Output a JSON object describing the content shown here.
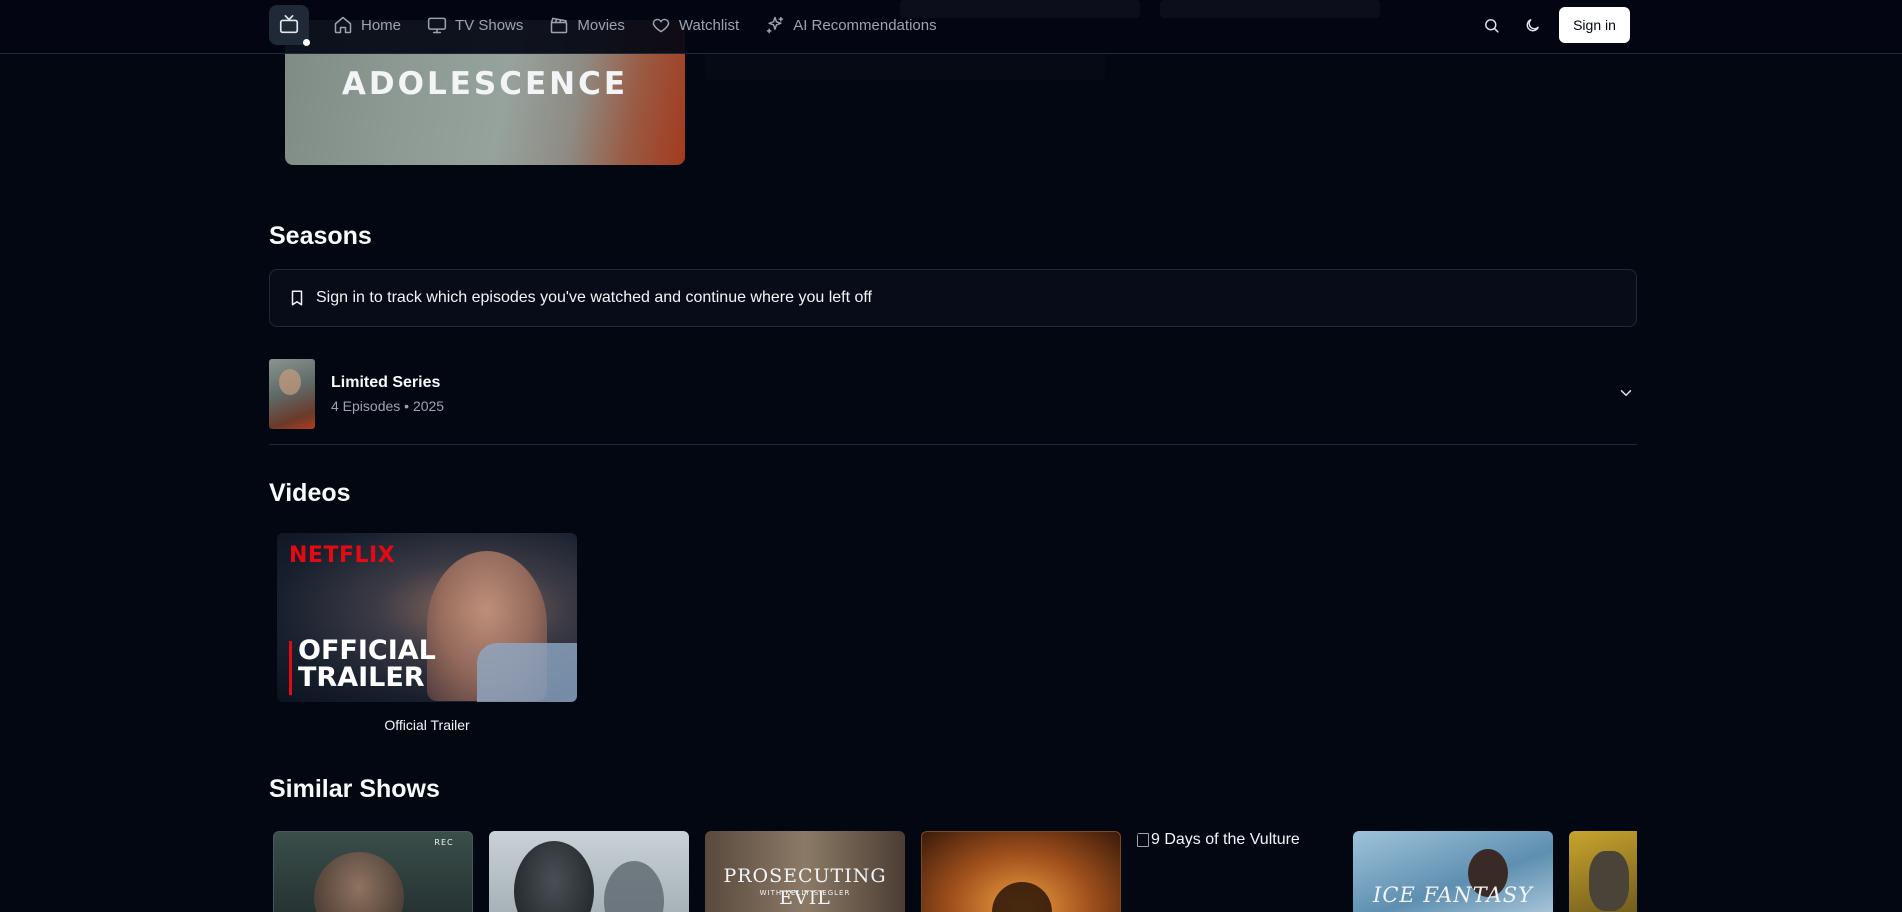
{
  "nav": {
    "items": [
      {
        "label": "Home",
        "icon": "home-icon"
      },
      {
        "label": "TV Shows",
        "icon": "tv-icon"
      },
      {
        "label": "Movies",
        "icon": "clapperboard-icon"
      },
      {
        "label": "Watchlist",
        "icon": "heart-icon"
      },
      {
        "label": "AI Recommendations",
        "icon": "sparkles-icon"
      }
    ],
    "sign_in_label": "Sign in"
  },
  "hero": {
    "poster_title": "ADOLESCENCE"
  },
  "seasons": {
    "heading": "Seasons",
    "notice_text": "Sign in to track which episodes you've watched and continue where you left off",
    "items": [
      {
        "title": "Limited Series",
        "meta": "4 Episodes • 2025"
      }
    ]
  },
  "videos": {
    "heading": "Videos",
    "items": [
      {
        "brand": "NETFLIX",
        "overlay": "OFFICIAL TRAILER",
        "caption": "Official Trailer"
      }
    ]
  },
  "similar": {
    "heading": "Similar Shows",
    "items": [
      {
        "poster_text": "REC"
      },
      {
        "poster_text": ""
      },
      {
        "poster_text": "PROSECUTING EVIL",
        "subtitle": "WITH KELLY SIEGLER"
      },
      {
        "poster_text": ""
      },
      {
        "alt": "9 Days of the Vulture"
      },
      {
        "poster_text": "ICE FANTASY"
      },
      {
        "poster_text": ""
      }
    ]
  },
  "colors": {
    "background": "#030712",
    "border": "#1f2937",
    "muted_text": "#9ca3af",
    "primary_button": "#ffffff"
  }
}
